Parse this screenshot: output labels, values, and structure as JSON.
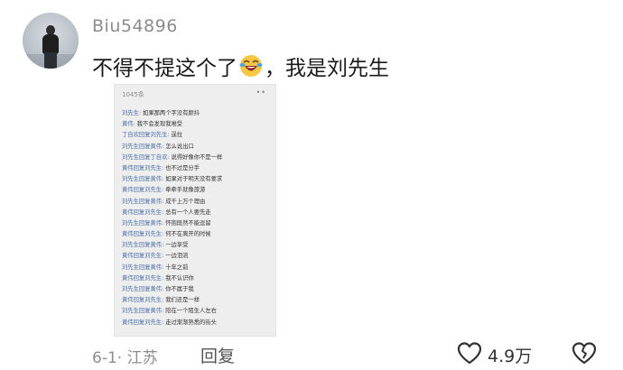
{
  "user": {
    "name": "Biu54896"
  },
  "comment": {
    "text_before": "不得不提这个了",
    "text_after": "，我是刘先生",
    "emoji_icon": "laughing-crying-face-icon"
  },
  "screenshot": {
    "header": "1045条",
    "more": "••",
    "lines": [
      {
        "who": "刘先生:",
        "text": " 如果那两个字没有颜抖"
      },
      {
        "who": "黄伟:",
        "text": " 我不会发现我难受"
      },
      {
        "who": "丁自欢回复刘先生:",
        "text": " 逞拉"
      },
      {
        "who": "刘先生回复黄伟:",
        "text": " 怎么说出口"
      },
      {
        "who": "刘先生回复丁自欢:",
        "text": " 说得好像你不是一样"
      },
      {
        "who": "黄伟回复刘先生:",
        "text": " 也不过是分手"
      },
      {
        "who": "刘先生回复黄伟:",
        "text": " 如果对于明天没有要求"
      },
      {
        "who": "黄伟回复刘先生:",
        "text": " 牵牵手就像旅游"
      },
      {
        "who": "刘先生回复黄伟:",
        "text": " 成千上万个理由"
      },
      {
        "who": "黄伟回复刘先生:",
        "text": " 总有一个人要先走"
      },
      {
        "who": "刘先生回复黄伟:",
        "text": " 怀抱既然不能逗留"
      },
      {
        "who": "黄伟回复刘先生:",
        "text": " 何不在离开的时候"
      },
      {
        "who": "刘先生回复黄伟:",
        "text": " 一边享受"
      },
      {
        "who": "黄伟回复刘先生:",
        "text": " 一边泪流"
      },
      {
        "who": "刘先生回复黄伟:",
        "text": " 十年之前"
      },
      {
        "who": "黄伟回复刘先生:",
        "text": " 我不认识你"
      },
      {
        "who": "刘先生回复黄伟:",
        "text": " 你不属于我"
      },
      {
        "who": "黄伟回复刘先生:",
        "text": " 我们还是一样"
      },
      {
        "who": "刘先生回复黄伟:",
        "text": " 陪在一个陌生人左右"
      },
      {
        "who": "黄伟回复刘先生:",
        "text": " 走过渐渐熟悉的街头"
      }
    ]
  },
  "footer": {
    "meta": "6-1· 江苏",
    "reply": "回复",
    "likes": "4.9万",
    "like_icon": "heart-outline-icon",
    "dislike_icon": "broken-heart-icon"
  }
}
